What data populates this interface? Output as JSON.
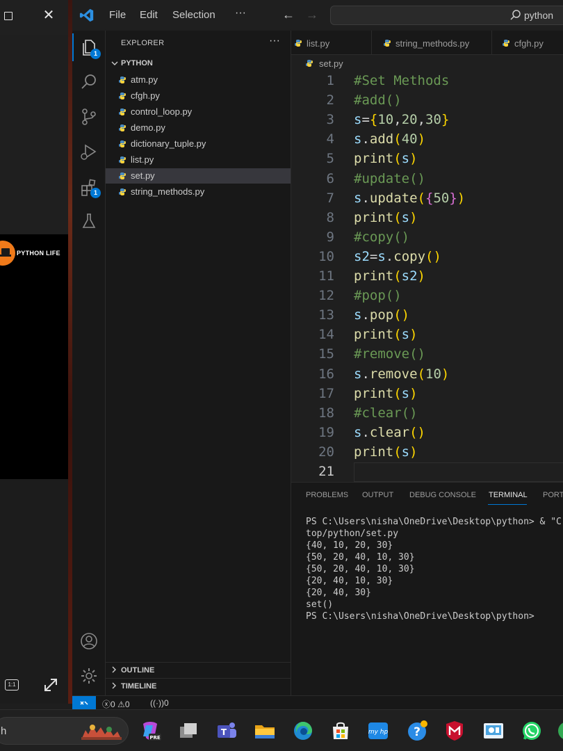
{
  "side_window": {
    "logo_text": "PYTHON LIFE",
    "ratio_label": "1:1"
  },
  "titlebar": {
    "menu": [
      "File",
      "Edit",
      "Selection"
    ],
    "more": "···",
    "search_text": "python"
  },
  "activity": {
    "explorer_badge": "1",
    "extensions_badge": "1"
  },
  "sidebar": {
    "title": "EXPLORER",
    "more": "···",
    "folder": "PYTHON",
    "files": [
      "atm.py",
      "cfgh.py",
      "control_loop.py",
      "demo.py",
      "dictionary_tuple.py",
      "list.py",
      "set.py",
      "string_methods.py"
    ],
    "selected_index": 6,
    "outline": "OUTLINE",
    "timeline": "TIMELINE"
  },
  "tabs": [
    "list.py",
    "string_methods.py",
    "cfgh.py"
  ],
  "breadcrumb": "set.py",
  "editor": {
    "lines": [
      [
        {
          "t": "#Set Methods",
          "c": "comment"
        }
      ],
      [
        {
          "t": "#add()",
          "c": "comment"
        }
      ],
      [
        {
          "t": "s",
          "c": "var"
        },
        {
          "t": "=",
          "c": "plain"
        },
        {
          "t": "{",
          "c": "br1"
        },
        {
          "t": "10",
          "c": "num"
        },
        {
          "t": ",",
          "c": "plain"
        },
        {
          "t": "20",
          "c": "num"
        },
        {
          "t": ",",
          "c": "plain"
        },
        {
          "t": "30",
          "c": "num"
        },
        {
          "t": "}",
          "c": "br1"
        }
      ],
      [
        {
          "t": "s",
          "c": "var"
        },
        {
          "t": ".",
          "c": "plain"
        },
        {
          "t": "add",
          "c": "func"
        },
        {
          "t": "(",
          "c": "br1"
        },
        {
          "t": "40",
          "c": "num"
        },
        {
          "t": ")",
          "c": "br1"
        }
      ],
      [
        {
          "t": "print",
          "c": "func"
        },
        {
          "t": "(",
          "c": "br1"
        },
        {
          "t": "s",
          "c": "var"
        },
        {
          "t": ")",
          "c": "br1"
        }
      ],
      [
        {
          "t": "#update()",
          "c": "comment"
        }
      ],
      [
        {
          "t": "s",
          "c": "var"
        },
        {
          "t": ".",
          "c": "plain"
        },
        {
          "t": "update",
          "c": "func"
        },
        {
          "t": "(",
          "c": "br1"
        },
        {
          "t": "{",
          "c": "br2"
        },
        {
          "t": "50",
          "c": "num"
        },
        {
          "t": "}",
          "c": "br2"
        },
        {
          "t": ")",
          "c": "br1"
        }
      ],
      [
        {
          "t": "print",
          "c": "func"
        },
        {
          "t": "(",
          "c": "br1"
        },
        {
          "t": "s",
          "c": "var"
        },
        {
          "t": ")",
          "c": "br1"
        }
      ],
      [
        {
          "t": "#copy()",
          "c": "comment"
        }
      ],
      [
        {
          "t": "s2",
          "c": "var"
        },
        {
          "t": "=",
          "c": "plain"
        },
        {
          "t": "s",
          "c": "var"
        },
        {
          "t": ".",
          "c": "plain"
        },
        {
          "t": "copy",
          "c": "func"
        },
        {
          "t": "()",
          "c": "br1"
        }
      ],
      [
        {
          "t": "print",
          "c": "func"
        },
        {
          "t": "(",
          "c": "br1"
        },
        {
          "t": "s2",
          "c": "var"
        },
        {
          "t": ")",
          "c": "br1"
        }
      ],
      [
        {
          "t": "#pop()",
          "c": "comment"
        }
      ],
      [
        {
          "t": "s",
          "c": "var"
        },
        {
          "t": ".",
          "c": "plain"
        },
        {
          "t": "pop",
          "c": "func"
        },
        {
          "t": "()",
          "c": "br1"
        }
      ],
      [
        {
          "t": "print",
          "c": "func"
        },
        {
          "t": "(",
          "c": "br1"
        },
        {
          "t": "s",
          "c": "var"
        },
        {
          "t": ")",
          "c": "br1"
        }
      ],
      [
        {
          "t": "#remove()",
          "c": "comment"
        }
      ],
      [
        {
          "t": "s",
          "c": "var"
        },
        {
          "t": ".",
          "c": "plain"
        },
        {
          "t": "remove",
          "c": "func"
        },
        {
          "t": "(",
          "c": "br1"
        },
        {
          "t": "10",
          "c": "num"
        },
        {
          "t": ")",
          "c": "br1"
        }
      ],
      [
        {
          "t": "print",
          "c": "func"
        },
        {
          "t": "(",
          "c": "br1"
        },
        {
          "t": "s",
          "c": "var"
        },
        {
          "t": ")",
          "c": "br1"
        }
      ],
      [
        {
          "t": "#clear()",
          "c": "comment"
        }
      ],
      [
        {
          "t": "s",
          "c": "var"
        },
        {
          "t": ".",
          "c": "plain"
        },
        {
          "t": "clear",
          "c": "func"
        },
        {
          "t": "()",
          "c": "br1"
        }
      ],
      [
        {
          "t": "print",
          "c": "func"
        },
        {
          "t": "(",
          "c": "br1"
        },
        {
          "t": "s",
          "c": "var"
        },
        {
          "t": ")",
          "c": "br1"
        }
      ],
      []
    ],
    "current_line": 21
  },
  "panel": {
    "tabs": [
      "PROBLEMS",
      "OUTPUT",
      "DEBUG CONSOLE",
      "TERMINAL",
      "PORTS"
    ],
    "active_tab": "TERMINAL",
    "terminal_lines": [
      "PS C:\\Users\\nisha\\OneDrive\\Desktop\\python> & \"C",
      "top/python/set.py",
      "{40, 10, 20, 30}",
      "{50, 20, 40, 10, 30}",
      "{50, 20, 40, 10, 30}",
      "{20, 40, 10, 30}",
      "{20, 40, 30}",
      "set()",
      "PS C:\\Users\\nisha\\OneDrive\\Desktop\\python>"
    ]
  },
  "status": {
    "errors": "0",
    "warnings": "0",
    "ports": "0"
  },
  "taskbar": {
    "search_text": "h"
  },
  "colors": {
    "accent": "#0078d4",
    "comment": "#6a9955",
    "function": "#dcdcaa",
    "number": "#b5cea8",
    "variable": "#9cdcfe",
    "bracket_gold": "#ffd700",
    "bracket_purple": "#da70d6",
    "python_logo_orange": "#f07a1a"
  }
}
